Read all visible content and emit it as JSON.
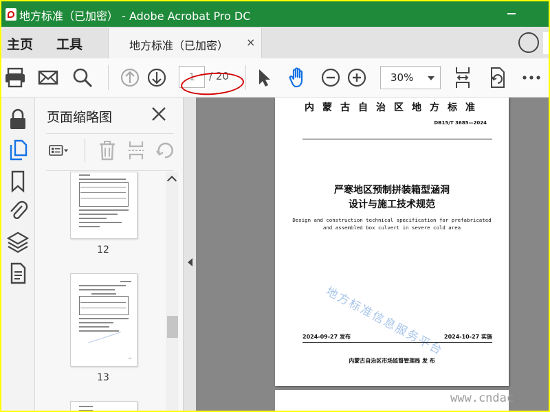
{
  "window": {
    "title": "地方标准（已加密） - Adobe Acrobat Pro DC"
  },
  "menubar": {
    "home": "主页",
    "tools": "工具",
    "doc_tab_label": "地方标准（已加密）",
    "doc_tab_close": "×"
  },
  "toolbar": {
    "icons": [
      "printer-icon",
      "mail-icon",
      "search-icon",
      "page-up-icon",
      "page-down-icon",
      "select-arrow-icon",
      "hand-icon",
      "zoom-out-icon",
      "zoom-in-icon",
      "fit-page-icon",
      "rotate-page-icon",
      "more-icon"
    ],
    "page_current": "1",
    "page_total": "/ 20",
    "zoom": "30%"
  },
  "rail": {
    "icons": [
      "lock-icon",
      "pages-icon",
      "bookmark-icon",
      "attachment-icon",
      "layers-icon",
      "document-icon"
    ]
  },
  "panel": {
    "title": "页面缩略图",
    "thumbnails": [
      {
        "page": "12"
      },
      {
        "page": "13"
      }
    ]
  },
  "document": {
    "header": "内蒙古自治区地方标准",
    "code": "DB15/T 3685—2024",
    "title_line1": "严寒地区预制拼装箱型涵洞",
    "title_line2": "设计与施工技术规范",
    "en_line1": "Design and construction technical specification for prefabricated",
    "en_line2": "and assembled box culvert in severe cold area",
    "watermark": "地方标准信息服务平台",
    "publish_date": "2024-09-27 发布",
    "implement_date": "2024-10-27 实施",
    "issuer": "内蒙古自治区市场监督管理局   发 布"
  },
  "site_watermark": "www.cndac",
  "colors": {
    "titlebar": "#1f8a3a",
    "annotation": "#d40000",
    "frame": "#ffff00"
  }
}
